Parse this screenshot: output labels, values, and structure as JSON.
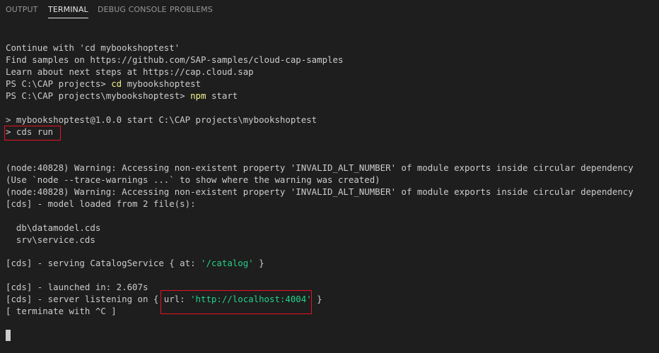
{
  "tabs": [
    {
      "label": "OUTPUT"
    },
    {
      "label": "TERMINAL"
    },
    {
      "label": "DEBUG CONSOLE"
    },
    {
      "label": "PROBLEMS"
    }
  ],
  "active_tab": "TERMINAL",
  "terminal": {
    "lines": {
      "l1": "Continue with 'cd mybookshoptest'",
      "l2": "Find samples on https://github.com/SAP-samples/cloud-cap-samples",
      "l3": "Learn about next steps at https://cap.cloud.sap",
      "l4_prompt": "PS C:\\CAP projects> ",
      "l4_cmd": "cd",
      "l4_arg": " mybookshoptest",
      "l5_prompt": "PS C:\\CAP projects\\mybookshoptest> ",
      "l5_cmd": "npm",
      "l5_arg": " start",
      "l6": "> mybookshoptest@1.0.0 start C:\\CAP projects\\mybookshoptest",
      "l7": "> cds run",
      "l8": "(node:40828) Warning: Accessing non-existent property 'INVALID_ALT_NUMBER' of module exports inside circular dependency",
      "l9": "(Use `node --trace-warnings ...` to show where the warning was created)",
      "l10": "(node:40828) Warning: Accessing non-existent property 'INVALID_ALT_NUMBER' of module exports inside circular dependency",
      "l11": "[cds] - model loaded from 2 file(s):",
      "l12": "  db\\datamodel.cds",
      "l13": "  srv\\service.cds",
      "l14_pre": "[cds] - serving CatalogService { at: ",
      "l14_str": "'/catalog'",
      "l14_post": " }",
      "l15": "[cds] - launched in: 2.607s",
      "l16_pre": "[cds] - server listening on { url: ",
      "l16_str": "'http://localhost:4004'",
      "l16_post": " }",
      "l17": "[ terminate with ^C ]"
    }
  },
  "colors": {
    "background": "#1e1e1e",
    "text": "#cccccc",
    "command": "#f2f28a",
    "string": "#23d18b",
    "highlight_box": "#e81123"
  }
}
